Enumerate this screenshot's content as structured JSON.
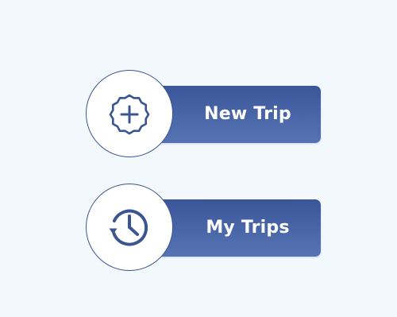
{
  "buttons": {
    "new_trip": {
      "label": "New Trip",
      "icon": "badge-plus-icon"
    },
    "my_trips": {
      "label": "My Trips",
      "icon": "history-clock-icon"
    }
  },
  "colors": {
    "background": "#f3f8fd",
    "button_gradient_top": "#3a5699",
    "button_gradient_bottom": "#5674b4",
    "icon_stroke": "#3b5591",
    "label_text": "#ffffff"
  }
}
